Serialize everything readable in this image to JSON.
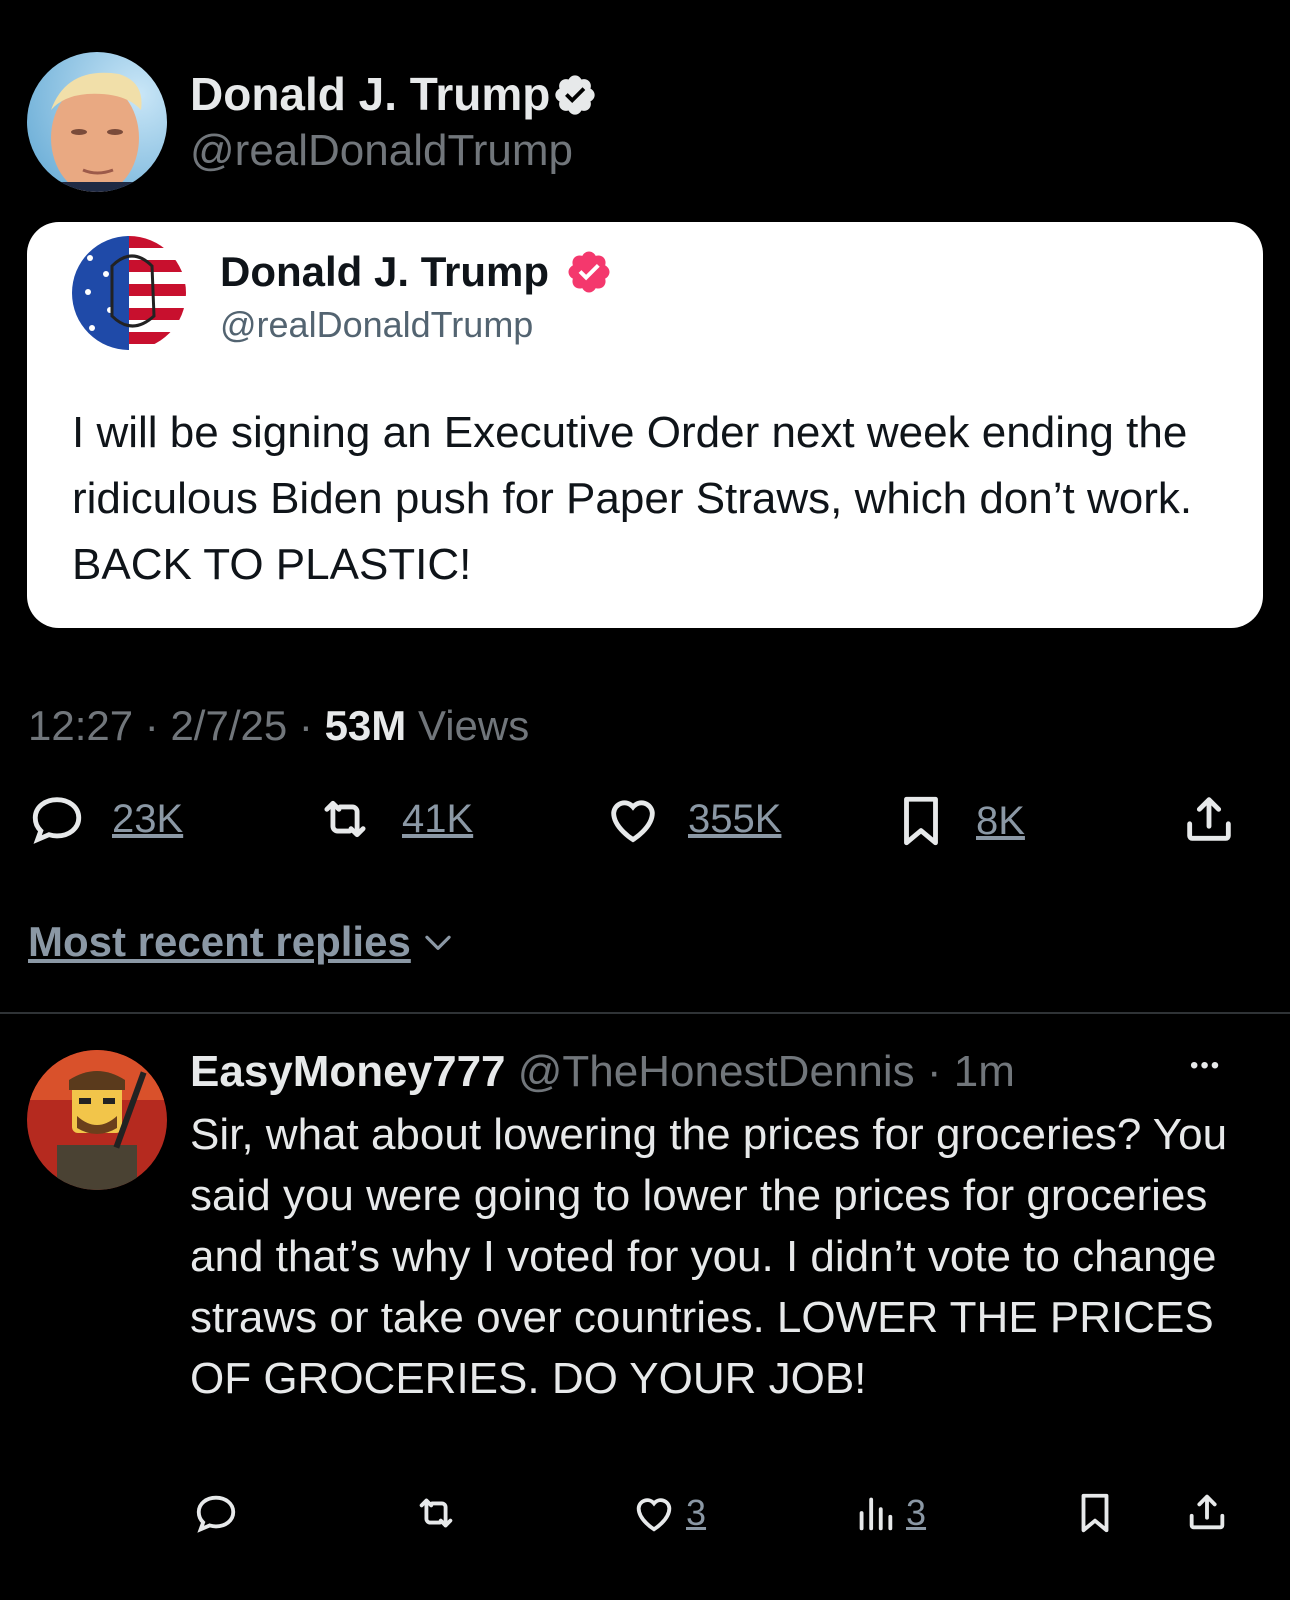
{
  "tweet": {
    "author_name": "Donald J. Trump",
    "author_handle": "@realDonaldTrump",
    "embed": {
      "author_name": "Donald J. Trump",
      "author_handle": "@realDonaldTrump",
      "text": "I will be signing an Executive Order next week ending the ridiculous Biden push for Paper Straws, which don’t work. BACK TO PLASTIC!"
    },
    "time": "12:27",
    "date": "2/7/25",
    "views_count": "53M",
    "views_label": "Views",
    "separator": "·",
    "actions": {
      "replies": "23K",
      "reposts": "41K",
      "likes": "355K",
      "bookmarks": "8K"
    }
  },
  "sort": {
    "label": "Most recent replies"
  },
  "reply": {
    "author_name": "EasyMoney777",
    "author_handle": "@TheHonestDennis",
    "time": "· 1m",
    "more": "•••",
    "text": "Sir, what about lowering the prices for groceries? You said you were going to lower the prices for groceries and that’s why I voted for you. I didn’t vote to change straws or take over countries. LOWER THE PRICES OF GROCERIES. DO YOUR JOB!",
    "actions": {
      "likes": "3",
      "views": "3"
    }
  },
  "colors": {
    "background": "#000000",
    "text": "#e7e9ea",
    "muted": "#71767b",
    "verified_blue": "#1d9bf0",
    "verified_pink": "#f4386d",
    "divider": "#2f3336"
  },
  "icons": [
    "verified-badge-icon",
    "reply-icon",
    "repost-icon",
    "like-icon",
    "bookmark-icon",
    "share-icon",
    "views-icon",
    "chevron-down-icon",
    "more-icon"
  ]
}
